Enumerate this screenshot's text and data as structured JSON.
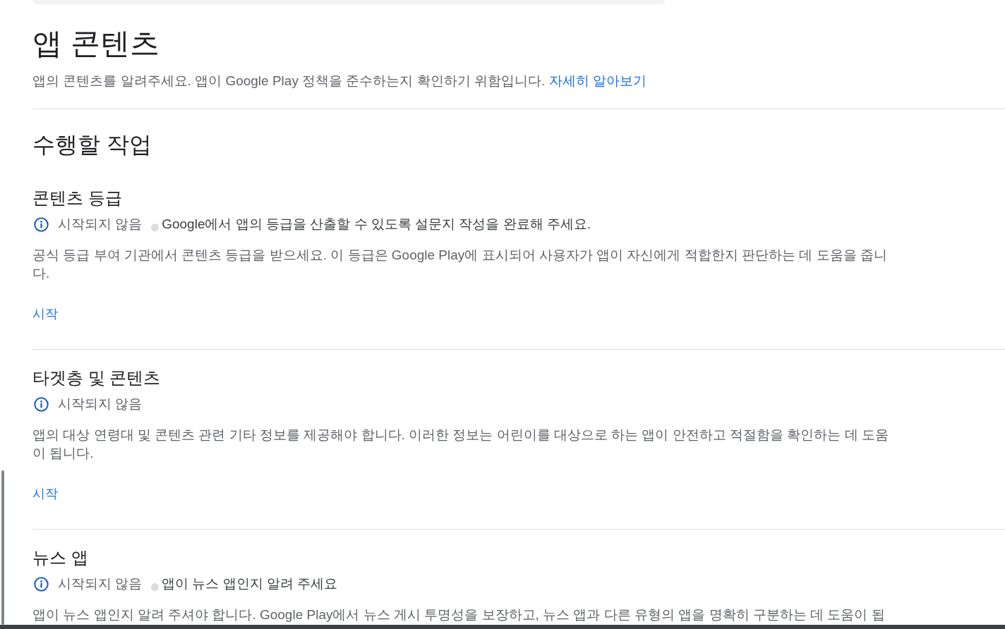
{
  "page": {
    "title": "앱 콘텐츠",
    "subtitle": "앱의 콘텐츠를 알려주세요. 앱이 Google Play 정책을 준수하는지 확인하기 위함입니다.",
    "learn_more_link": "자세히 알아보기"
  },
  "tasks_section": {
    "heading": "수행할 작업",
    "tasks": [
      {
        "title": "콘텐츠 등급",
        "status": "시작되지 않음",
        "message": "Google에서 앱의 등급을 산출할 수 있도록 설문지 작성을 완료해 주세요.",
        "description": "공식 등급 부여 기관에서 콘텐츠 등급을 받으세요. 이 등급은 Google Play에 표시되어 사용자가 앱이 자신에게 적합한지 판단하는 데 도움을 줍니다.",
        "action": "시작"
      },
      {
        "title": "타겟층 및 콘텐츠",
        "status": "시작되지 않음",
        "description": "앱의 대상 연령대 및 콘텐츠 관련 기타 정보를 제공해야 합니다. 이러한 정보는 어린이를 대상으로 하는 앱이 안전하고 적절함을 확인하는 데 도움이 됩니다.",
        "action": "시작"
      },
      {
        "title": "뉴스 앱",
        "status": "시작되지 않음",
        "message": "앱이 뉴스 앱인지 알려 주세요",
        "description": "앱이 뉴스 앱인지 알려 주셔야 합니다. Google Play에서 뉴스 게시 투명성을 보장하고, 뉴스 앱과 다른 유형의 앱을 명확히 구분하는 데 도움이 됩"
      }
    ]
  }
}
